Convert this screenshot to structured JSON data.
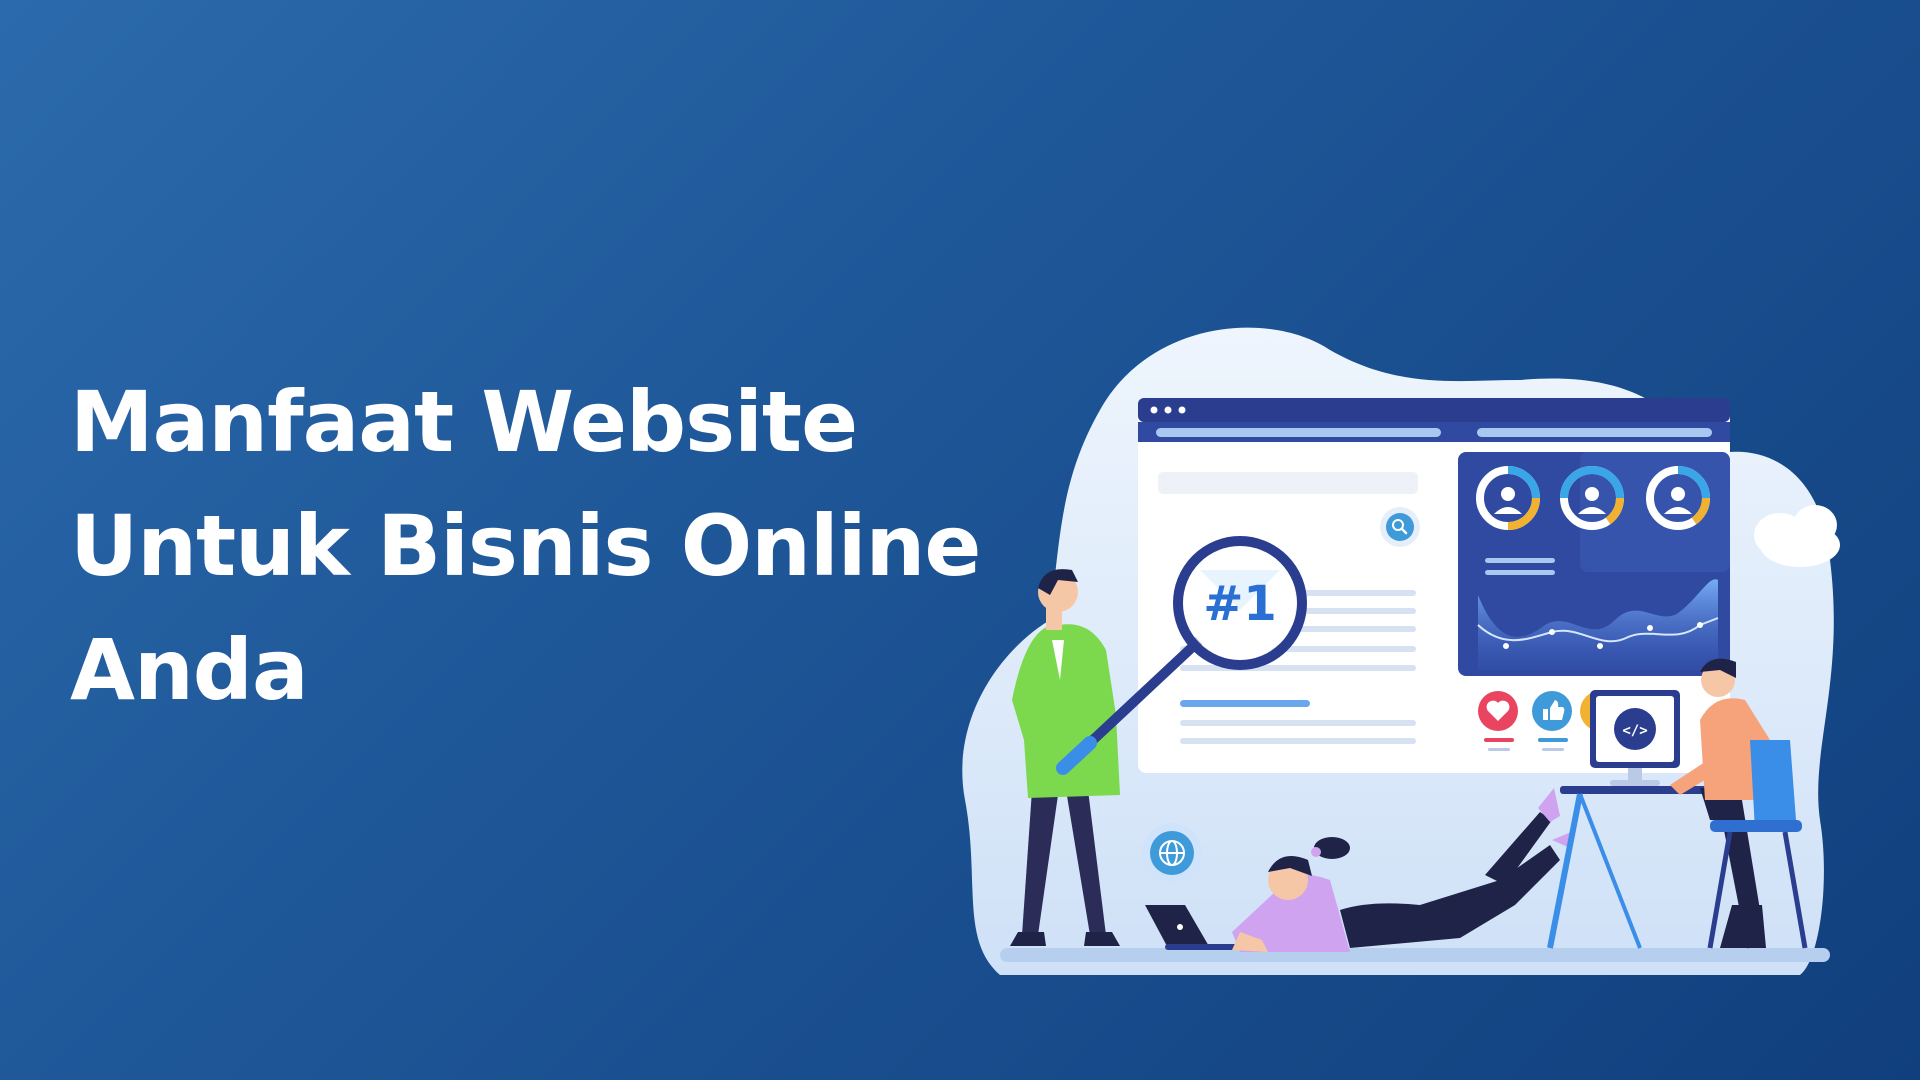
{
  "headline": {
    "line1": "Manfaat Website",
    "line2": "Untuk Bisnis Online",
    "line3": "Anda"
  },
  "illustration": {
    "rank_text": "#1",
    "code_text": "</>"
  },
  "colors": {
    "background_start": "#2b6aac",
    "background_end": "#113f7d",
    "blob": "#dbe9fb",
    "browser_bar": "#2a3d8f",
    "green_shirt": "#7cd94d",
    "orange_shirt": "#f6a37c",
    "purple_shirt": "#cfa3f0",
    "chair": "#3a8ee8"
  },
  "icons": [
    "magnifier-icon",
    "search-icon",
    "user-donut-icon",
    "heart-icon",
    "thumbs-up-icon",
    "globe-icon",
    "code-icon",
    "laptop-icon",
    "cloud-icon"
  ]
}
